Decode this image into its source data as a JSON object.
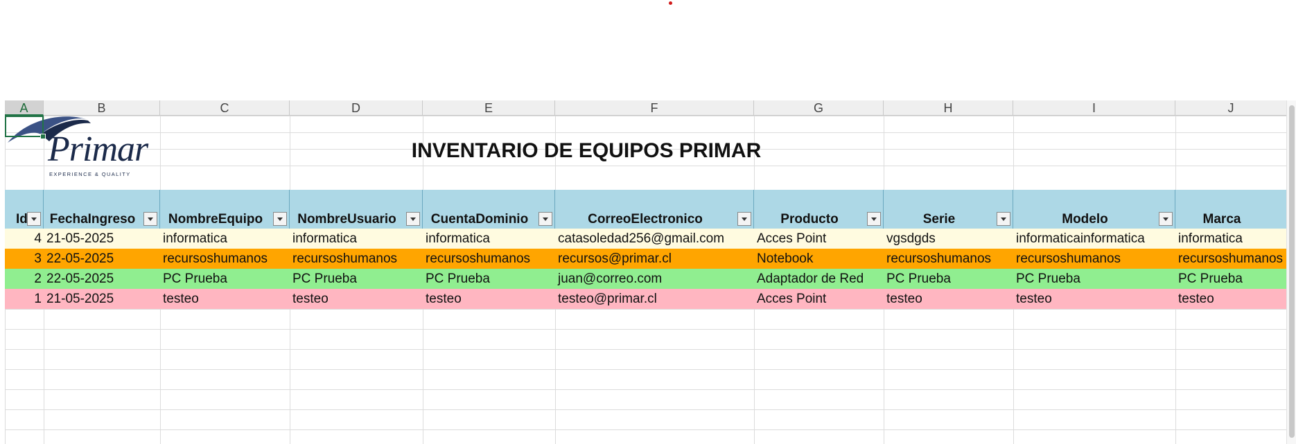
{
  "columns": [
    "A",
    "B",
    "C",
    "D",
    "E",
    "F",
    "G",
    "H",
    "I",
    "J"
  ],
  "active_column": "A",
  "logo": {
    "word": "Primar",
    "tagline": "EXPERIENCE & QUALITY"
  },
  "title": "INVENTARIO DE EQUIPOS PRIMAR",
  "table": {
    "headers": [
      "Id",
      "FechaIngreso",
      "NombreEquipo",
      "NombreUsuario",
      "CuentaDominio",
      "CorreoElectronico",
      "Producto",
      "Serie",
      "Modelo",
      "Marca"
    ],
    "rows": [
      {
        "bg": "#fffbe0",
        "cells": [
          "4",
          "21-05-2025",
          "informatica",
          "informatica",
          "informatica",
          "catasoledad256@gmail.com",
          "Acces Point",
          "vgsdgds",
          "informaticainformatica",
          "informatica"
        ]
      },
      {
        "bg": "#ffa500",
        "cells": [
          "3",
          "22-05-2025",
          "recursoshumanos",
          "recursoshumanos",
          "recursoshumanos",
          "recursos@primar.cl",
          "Notebook",
          "recursoshumanos",
          "recursoshumanos",
          "recursoshumanos"
        ]
      },
      {
        "bg": "#90ee90",
        "cells": [
          "2",
          "22-05-2025",
          "PC Prueba",
          "PC Prueba",
          "PC Prueba",
          "juan@correo.com",
          "Adaptador de Red",
          "PC Prueba",
          "PC Prueba",
          "PC Prueba"
        ]
      },
      {
        "bg": "#ffb6c1",
        "cells": [
          "1",
          "21-05-2025",
          "testeo",
          "testeo",
          "testeo",
          "testeo@primar.cl",
          "Acces Point",
          "testeo",
          "testeo",
          "testeo"
        ]
      }
    ]
  },
  "colors": {
    "header_fill": "#add8e6",
    "selection": "#217346"
  }
}
